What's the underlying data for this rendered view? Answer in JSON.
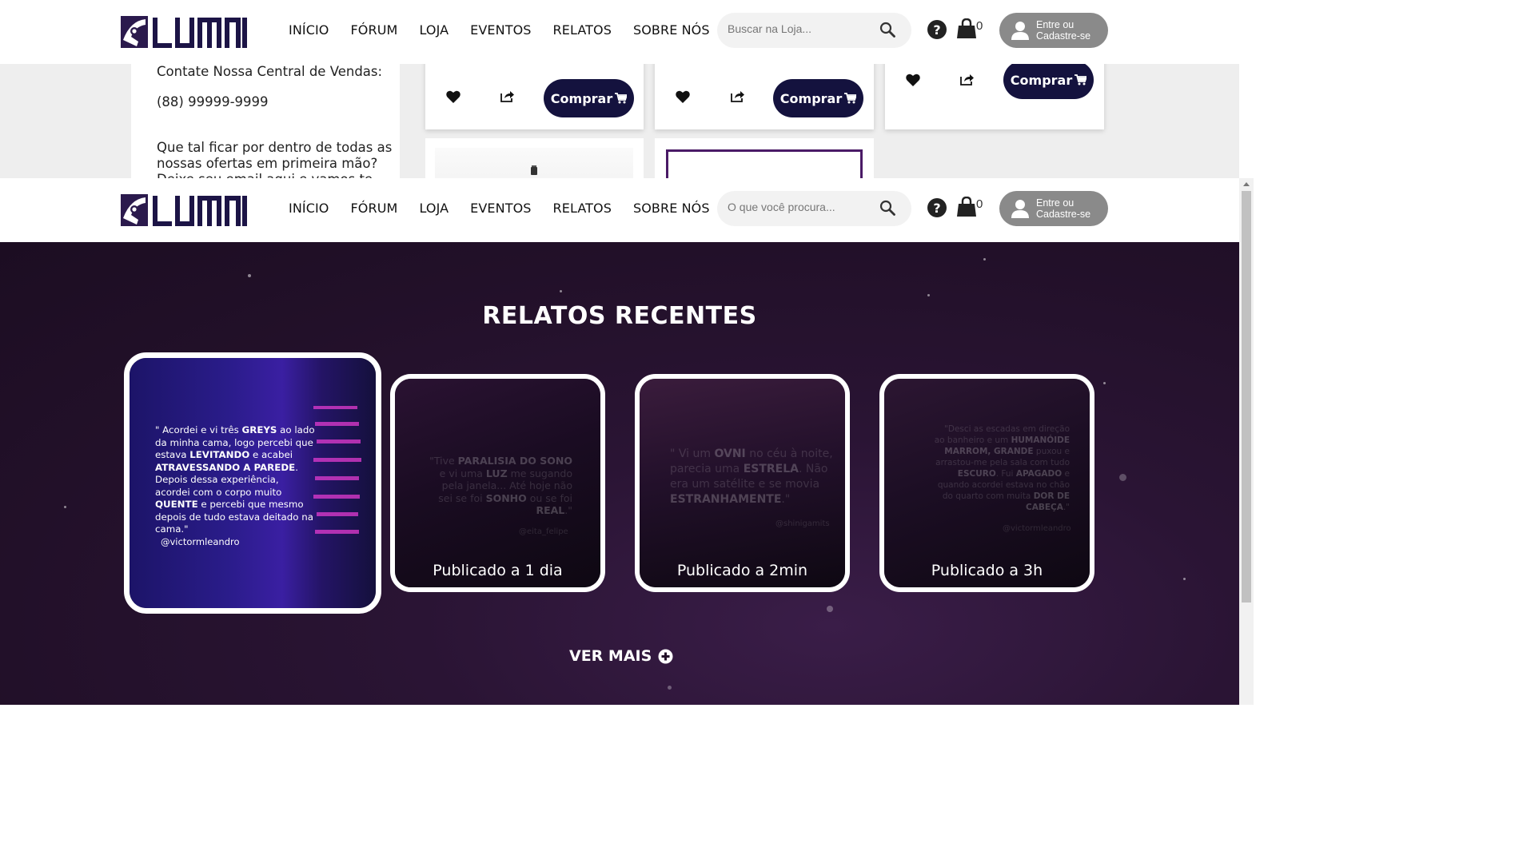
{
  "nav": {
    "logo_text": "LUMNI",
    "links": [
      "INÍCIO",
      "FÓRUM",
      "LOJA",
      "EVENTOS",
      "RELATOS",
      "SOBRE NÓS"
    ],
    "search_placeholder_top": "Buscar na Loja...",
    "search_placeholder_main": "O que você procura...",
    "cart_count": "0",
    "user_label_line1": "Entre ou",
    "user_label_line2": "Cadastre-se",
    "help_icon": "help-icon",
    "cart_icon": "shopping-bag-icon"
  },
  "shop": {
    "contact_title": "Contate Nossa Central de Vendas:",
    "contact_phone": "(88) 99999-9999",
    "promo_line1": "Que tal ficar por dentro de todas as",
    "promo_line2": "nossas ofertas em primeira mão?",
    "promo_line3": "Deixe seu email aqui e vamos te avisar:)",
    "buy_label": "Comprar"
  },
  "relatos": {
    "title": "RELATOS RECENTES",
    "ver_mais": "VER MAIS",
    "cards": [
      {
        "quote_html": "\" Acordei e vi três <b>GREYS</b> ao lado da minha cama, logo percebi que estava <b>LEVITANDO</b> e acabei <b>ATRAVESSANDO A PAREDE</b>. Depois dessa experiência, acordei com o corpo muito <b>QUENTE</b> e percebi que mesmo depois de tudo estava deitado na cama.\"",
        "handle": "@victormleandro",
        "published": ""
      },
      {
        "quote_html": "\"Tive <b>PARALISIA DO SONO</b> e vi uma <b>LUZ</b> me sugando pela janela... Até hoje não sei se foi <b>SONHO</b> ou se foi <b>REAL</b>.\"",
        "handle": "@eita_felipe",
        "published": "Publicado a 1 dia"
      },
      {
        "quote_html": "\" Vi um <b>OVNI</b> no céu à noite, parecia uma <b>ESTRELA</b>. Não era um satélite e se movia <b>ESTRANHAMENTE</b>.\"",
        "handle": "@shinigamits",
        "published": "Publicado a 2min"
      },
      {
        "quote_html": "\"Desci as escadas em direção ao banheiro e um <b>HUMANÓIDE MARROM, GRANDE</b> puxou e arrastou-me pela sala com tudo <b>ESCURO</b>. Fui <b>APAGADO</b> e quando acordei estava no chão do quarto com muita <b>DOR DE CABEÇA</b>.\"",
        "handle": "@victormleandro",
        "published": "Publicado a 3h"
      }
    ]
  },
  "colors": {
    "brand": "#14123e",
    "accent": "#4a1a66",
    "button_grey": "#8a8a8a"
  }
}
